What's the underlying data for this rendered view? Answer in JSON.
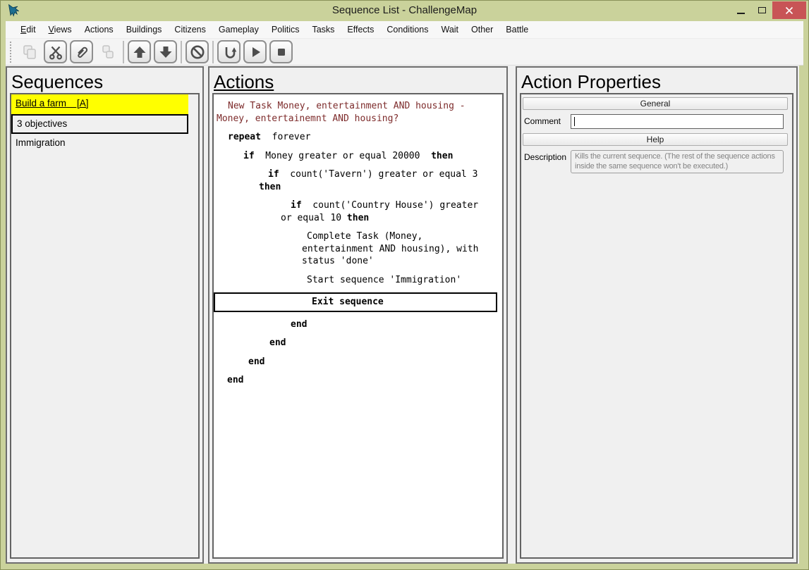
{
  "window": {
    "title": "Sequence List - ChallengeMap"
  },
  "menu": {
    "items": [
      {
        "label": "Edit",
        "accel_first": true
      },
      {
        "label": "Views",
        "accel_first": true
      },
      {
        "label": "Actions"
      },
      {
        "label": "Buildings"
      },
      {
        "label": "Citizens"
      },
      {
        "label": "Gameplay"
      },
      {
        "label": "Politics"
      },
      {
        "label": "Tasks"
      },
      {
        "label": "Effects"
      },
      {
        "label": "Conditions"
      },
      {
        "label": "Wait"
      },
      {
        "label": "Other"
      },
      {
        "label": "Battle"
      }
    ]
  },
  "toolbar": {
    "buttons": [
      {
        "icon": "copy",
        "disabled": true
      },
      {
        "icon": "cut"
      },
      {
        "icon": "paperclip"
      },
      {
        "icon": "duplicate",
        "disabled": true
      },
      {
        "sep": true
      },
      {
        "icon": "move-up"
      },
      {
        "icon": "move-down"
      },
      {
        "sep": true
      },
      {
        "icon": "block"
      },
      {
        "sep": true
      },
      {
        "icon": "return"
      },
      {
        "icon": "play"
      },
      {
        "icon": "stop"
      }
    ]
  },
  "sequences": {
    "heading": "Sequences",
    "items": [
      {
        "label": "Build a farm    [A]",
        "style": "highlight"
      },
      {
        "label": "3 objectives",
        "style": "selected"
      },
      {
        "label": "Immigration",
        "style": "plain"
      }
    ]
  },
  "actions": {
    "heading": "Actions",
    "rows": [
      {
        "color": "maroon",
        "hang": 4,
        "indent": 16,
        "segments": [
          {
            "t": "New Task Money, entertainment AND housing - Money, entertainemnt AND housing?",
            "b": false
          }
        ]
      },
      {
        "hang": 20,
        "indent": 0,
        "segments": [
          {
            "t": "repeat",
            "b": true
          },
          {
            "t": "  forever",
            "b": false
          }
        ]
      },
      {
        "hang": 29,
        "indent": 13,
        "segments": [
          {
            "t": "if",
            "b": true
          },
          {
            "t": "  Money greater or equal 20000  ",
            "b": false
          },
          {
            "t": "then",
            "b": true
          }
        ]
      },
      {
        "hang": 64,
        "indent": 13,
        "segments": [
          {
            "t": "if",
            "b": true
          },
          {
            "t": "  count('Tavern') greater or equal 3 ",
            "b": false
          },
          {
            "t": "then",
            "b": true
          }
        ]
      },
      {
        "hang": 95,
        "indent": 14,
        "segments": [
          {
            "t": "if",
            "b": true
          },
          {
            "t": "  count('Country House') greater or equal 10 ",
            "b": false
          },
          {
            "t": "then",
            "b": true
          }
        ]
      },
      {
        "hang": 125,
        "indent": 7,
        "segments": [
          {
            "t": "Complete Task (Money, entertainment AND housing), with status 'done'",
            "b": false
          }
        ]
      },
      {
        "hang": 125,
        "indent": 7,
        "segments": [
          {
            "t": "Start sequence 'Immigration'",
            "b": false
          }
        ]
      },
      {
        "selected": true,
        "hang": 137,
        "indent": 0,
        "segments": [
          {
            "t": "Exit sequence",
            "b": true
          }
        ]
      },
      {
        "hang": 109,
        "indent": 0,
        "segments": [
          {
            "t": "end",
            "b": true
          }
        ]
      },
      {
        "hang": 79,
        "indent": 0,
        "segments": [
          {
            "t": "end",
            "b": true
          }
        ]
      },
      {
        "hang": 49,
        "indent": 0,
        "segments": [
          {
            "t": "end",
            "b": true
          }
        ]
      },
      {
        "hang": 19,
        "indent": 0,
        "segments": [
          {
            "t": "end",
            "b": true
          }
        ]
      }
    ]
  },
  "properties": {
    "heading": "Action Properties",
    "general_label": "General",
    "comment_label": "Comment",
    "comment_value": "",
    "help_label": "Help",
    "description_label": "Description",
    "description_text": "Kills the current sequence. (The rest of the sequence actions inside the same sequence won't be executed.)"
  },
  "colors": {
    "titlebar_green": "#cad29b",
    "close_red": "#c85456",
    "highlight_yellow": "#ffff00",
    "selection_border": "#000000",
    "task_text_maroon": "#7d2b2b"
  }
}
